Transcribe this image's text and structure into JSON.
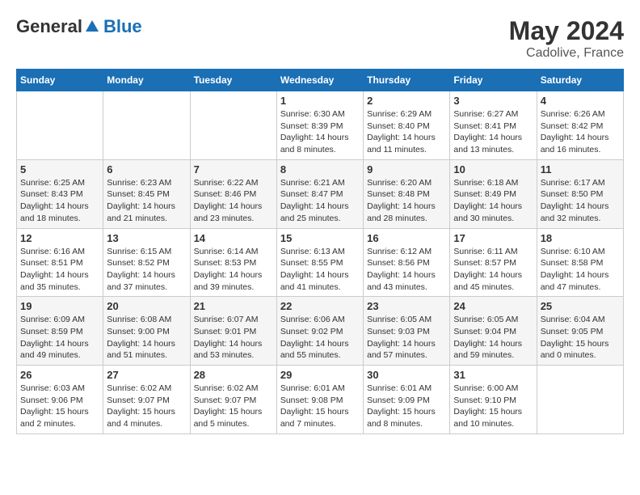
{
  "header": {
    "logo_general": "General",
    "logo_blue": "Blue",
    "month_year": "May 2024",
    "location": "Cadolive, France"
  },
  "days_of_week": [
    "Sunday",
    "Monday",
    "Tuesday",
    "Wednesday",
    "Thursday",
    "Friday",
    "Saturday"
  ],
  "weeks": [
    [
      {
        "day": "",
        "info": ""
      },
      {
        "day": "",
        "info": ""
      },
      {
        "day": "",
        "info": ""
      },
      {
        "day": "1",
        "info": "Sunrise: 6:30 AM\nSunset: 8:39 PM\nDaylight: 14 hours\nand 8 minutes."
      },
      {
        "day": "2",
        "info": "Sunrise: 6:29 AM\nSunset: 8:40 PM\nDaylight: 14 hours\nand 11 minutes."
      },
      {
        "day": "3",
        "info": "Sunrise: 6:27 AM\nSunset: 8:41 PM\nDaylight: 14 hours\nand 13 minutes."
      },
      {
        "day": "4",
        "info": "Sunrise: 6:26 AM\nSunset: 8:42 PM\nDaylight: 14 hours\nand 16 minutes."
      }
    ],
    [
      {
        "day": "5",
        "info": "Sunrise: 6:25 AM\nSunset: 8:43 PM\nDaylight: 14 hours\nand 18 minutes."
      },
      {
        "day": "6",
        "info": "Sunrise: 6:23 AM\nSunset: 8:45 PM\nDaylight: 14 hours\nand 21 minutes."
      },
      {
        "day": "7",
        "info": "Sunrise: 6:22 AM\nSunset: 8:46 PM\nDaylight: 14 hours\nand 23 minutes."
      },
      {
        "day": "8",
        "info": "Sunrise: 6:21 AM\nSunset: 8:47 PM\nDaylight: 14 hours\nand 25 minutes."
      },
      {
        "day": "9",
        "info": "Sunrise: 6:20 AM\nSunset: 8:48 PM\nDaylight: 14 hours\nand 28 minutes."
      },
      {
        "day": "10",
        "info": "Sunrise: 6:18 AM\nSunset: 8:49 PM\nDaylight: 14 hours\nand 30 minutes."
      },
      {
        "day": "11",
        "info": "Sunrise: 6:17 AM\nSunset: 8:50 PM\nDaylight: 14 hours\nand 32 minutes."
      }
    ],
    [
      {
        "day": "12",
        "info": "Sunrise: 6:16 AM\nSunset: 8:51 PM\nDaylight: 14 hours\nand 35 minutes."
      },
      {
        "day": "13",
        "info": "Sunrise: 6:15 AM\nSunset: 8:52 PM\nDaylight: 14 hours\nand 37 minutes."
      },
      {
        "day": "14",
        "info": "Sunrise: 6:14 AM\nSunset: 8:53 PM\nDaylight: 14 hours\nand 39 minutes."
      },
      {
        "day": "15",
        "info": "Sunrise: 6:13 AM\nSunset: 8:55 PM\nDaylight: 14 hours\nand 41 minutes."
      },
      {
        "day": "16",
        "info": "Sunrise: 6:12 AM\nSunset: 8:56 PM\nDaylight: 14 hours\nand 43 minutes."
      },
      {
        "day": "17",
        "info": "Sunrise: 6:11 AM\nSunset: 8:57 PM\nDaylight: 14 hours\nand 45 minutes."
      },
      {
        "day": "18",
        "info": "Sunrise: 6:10 AM\nSunset: 8:58 PM\nDaylight: 14 hours\nand 47 minutes."
      }
    ],
    [
      {
        "day": "19",
        "info": "Sunrise: 6:09 AM\nSunset: 8:59 PM\nDaylight: 14 hours\nand 49 minutes."
      },
      {
        "day": "20",
        "info": "Sunrise: 6:08 AM\nSunset: 9:00 PM\nDaylight: 14 hours\nand 51 minutes."
      },
      {
        "day": "21",
        "info": "Sunrise: 6:07 AM\nSunset: 9:01 PM\nDaylight: 14 hours\nand 53 minutes."
      },
      {
        "day": "22",
        "info": "Sunrise: 6:06 AM\nSunset: 9:02 PM\nDaylight: 14 hours\nand 55 minutes."
      },
      {
        "day": "23",
        "info": "Sunrise: 6:05 AM\nSunset: 9:03 PM\nDaylight: 14 hours\nand 57 minutes."
      },
      {
        "day": "24",
        "info": "Sunrise: 6:05 AM\nSunset: 9:04 PM\nDaylight: 14 hours\nand 59 minutes."
      },
      {
        "day": "25",
        "info": "Sunrise: 6:04 AM\nSunset: 9:05 PM\nDaylight: 15 hours\nand 0 minutes."
      }
    ],
    [
      {
        "day": "26",
        "info": "Sunrise: 6:03 AM\nSunset: 9:06 PM\nDaylight: 15 hours\nand 2 minutes."
      },
      {
        "day": "27",
        "info": "Sunrise: 6:02 AM\nSunset: 9:07 PM\nDaylight: 15 hours\nand 4 minutes."
      },
      {
        "day": "28",
        "info": "Sunrise: 6:02 AM\nSunset: 9:07 PM\nDaylight: 15 hours\nand 5 minutes."
      },
      {
        "day": "29",
        "info": "Sunrise: 6:01 AM\nSunset: 9:08 PM\nDaylight: 15 hours\nand 7 minutes."
      },
      {
        "day": "30",
        "info": "Sunrise: 6:01 AM\nSunset: 9:09 PM\nDaylight: 15 hours\nand 8 minutes."
      },
      {
        "day": "31",
        "info": "Sunrise: 6:00 AM\nSunset: 9:10 PM\nDaylight: 15 hours\nand 10 minutes."
      },
      {
        "day": "",
        "info": ""
      }
    ]
  ]
}
